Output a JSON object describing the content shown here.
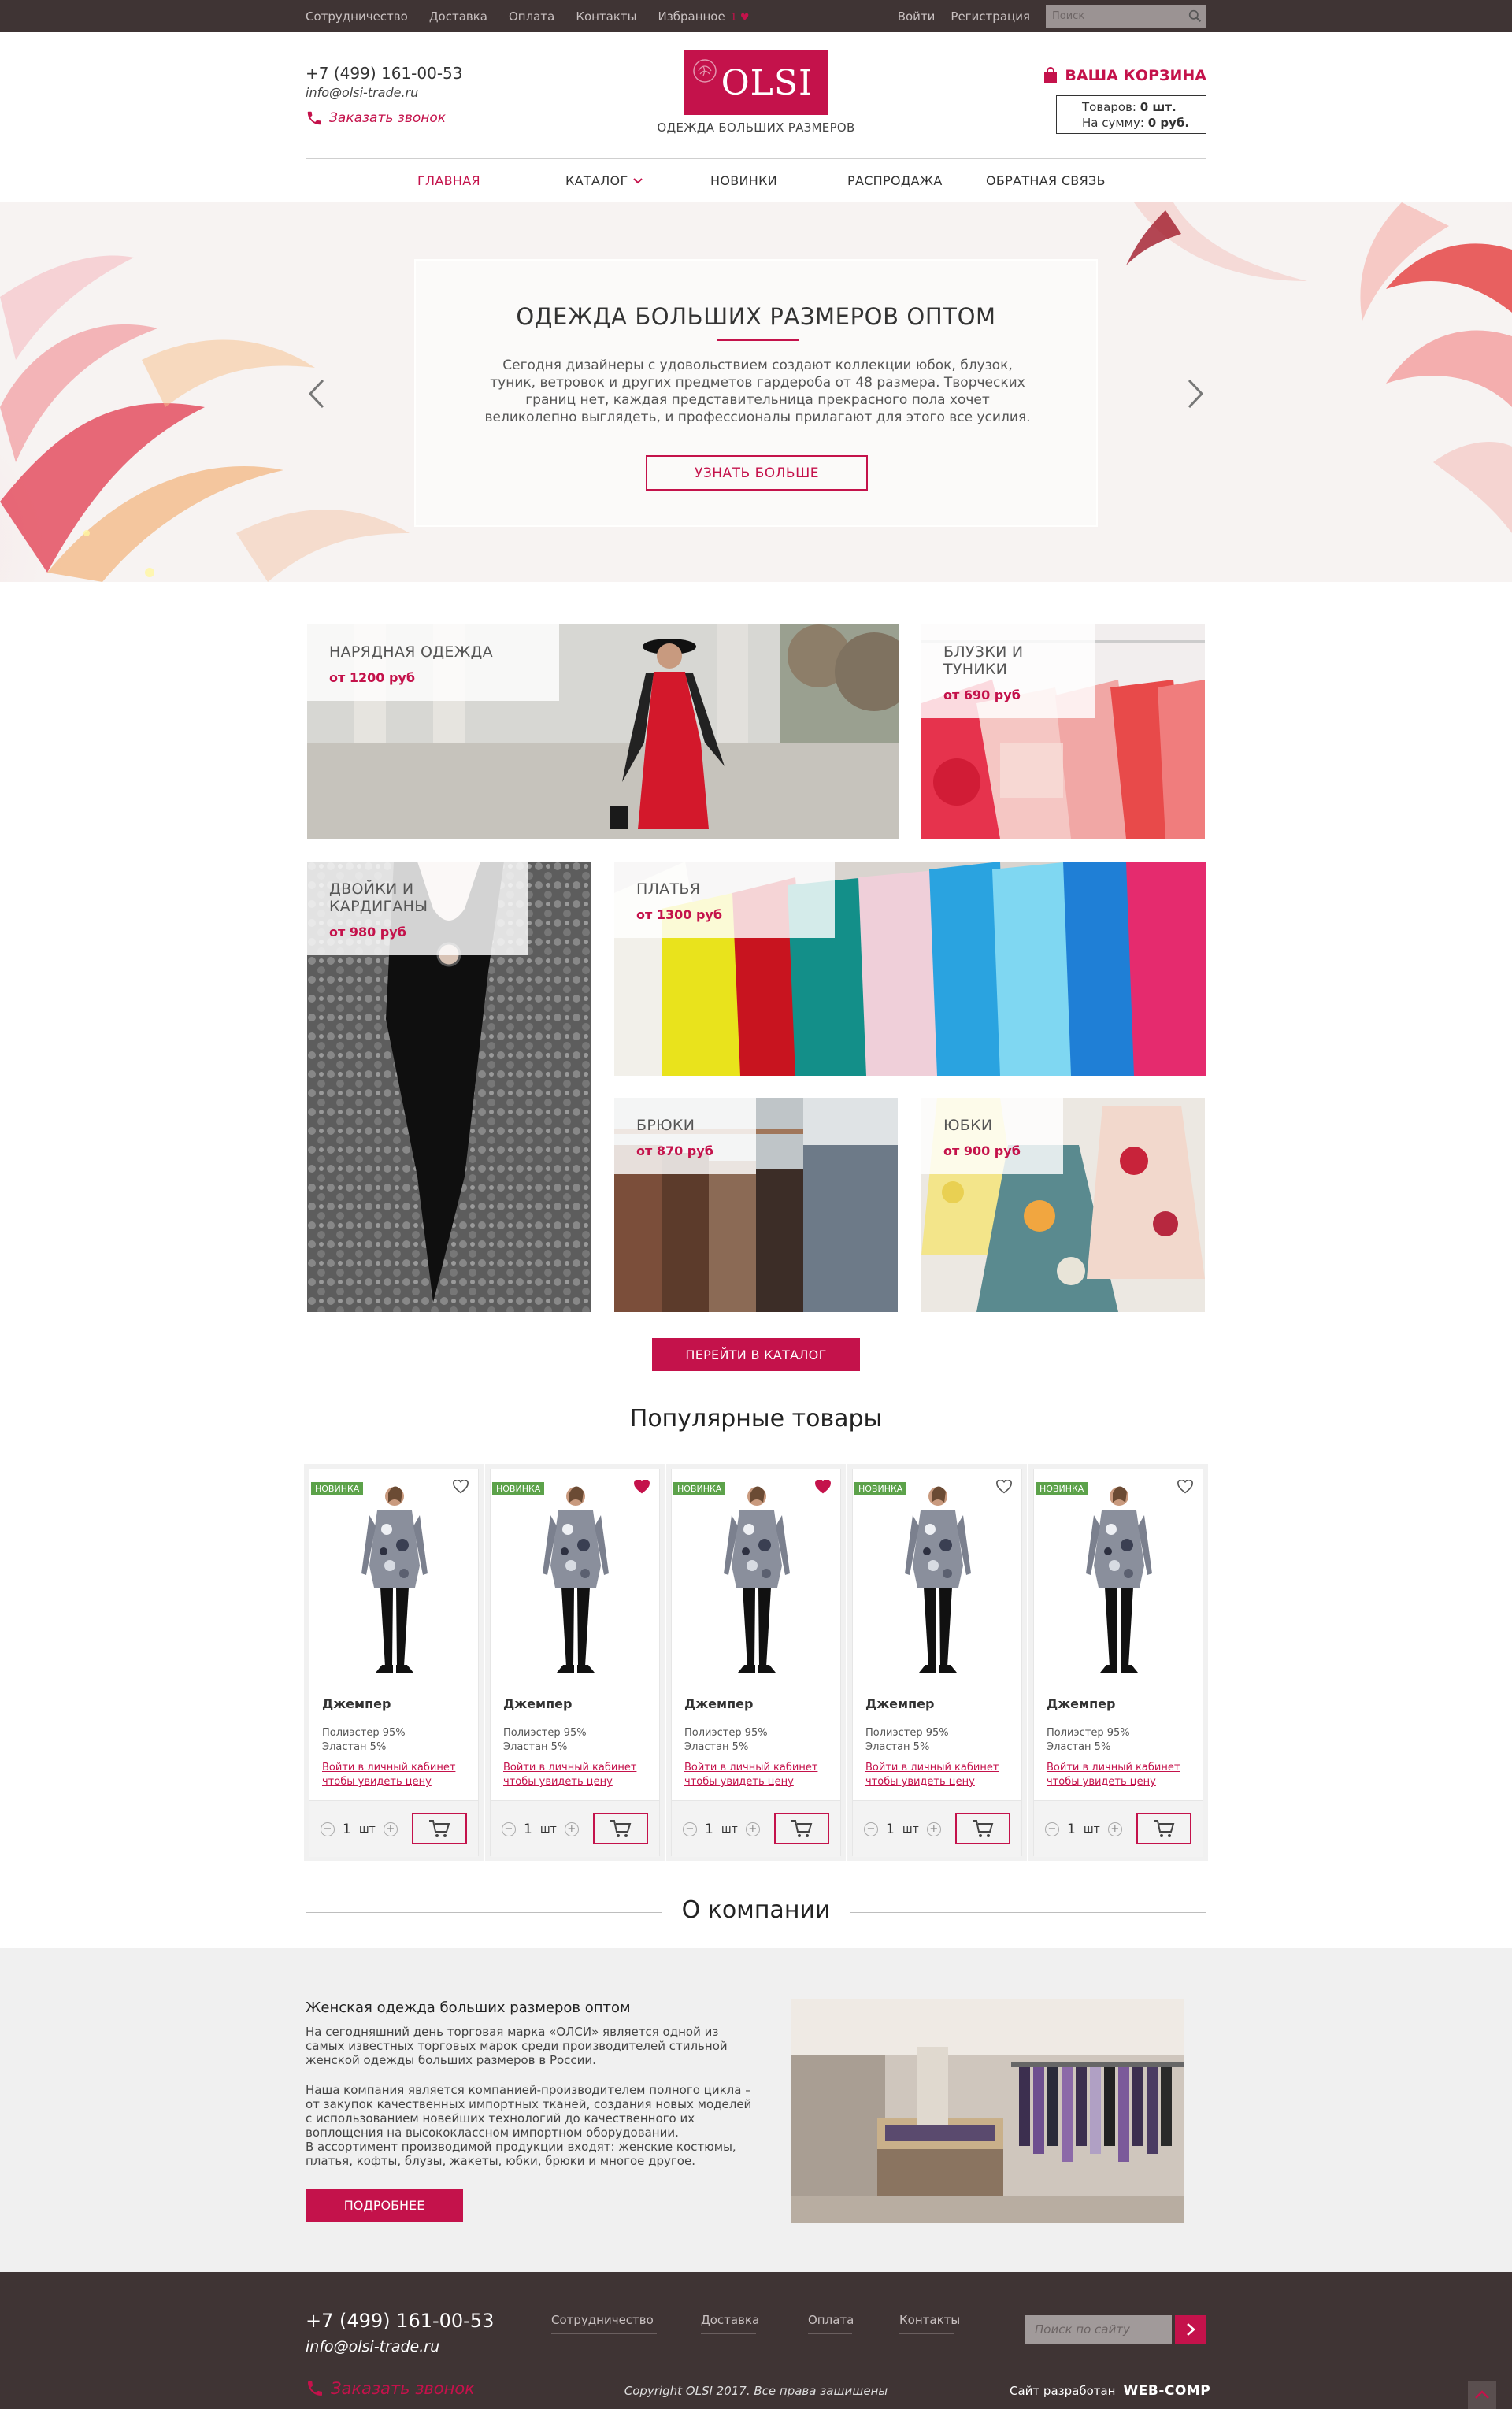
{
  "topbar": {
    "links": [
      "Сотрудничество",
      "Доставка",
      "Оплата",
      "Контакты",
      "Избранное"
    ],
    "fav_count": "1",
    "login": "Войти",
    "register": "Регистрация",
    "search_placeholder": "Поиск"
  },
  "header": {
    "phone": "+7 (499) 161-00-53",
    "email": "info@olsi-trade.ru",
    "callback": "Заказать звонок",
    "logo": "OLSI",
    "tagline": "ОДЕЖДА БОЛЬШИХ РАЗМЕРОВ",
    "cart_title": "ВАША КОРЗИНА",
    "cart_items_label": "Товаров:",
    "cart_items_value": "0 шт.",
    "cart_sum_label": "На сумму:",
    "cart_sum_value": "0 руб."
  },
  "nav": {
    "items": [
      "ГЛАВНАЯ",
      "КАТАЛОГ",
      "НОВИНКИ",
      "РАСПРОДАЖА",
      "ОБРАТНАЯ СВЯЗЬ"
    ]
  },
  "hero": {
    "title": "ОДЕЖДА БОЛЬШИХ РАЗМЕРОВ ОПТОМ",
    "text": "Сегодня дизайнеры с удовольствием создают коллекции юбок, блузок, туник, ветровок и других предметов гардероба от 48 размера. Творческих границ нет, каждая представительница прекрасного пола хочет великолепно выглядеть, и профессионалы прилагают для этого все усилия.",
    "button": "УЗНАТЬ БОЛЬШЕ"
  },
  "categories": [
    {
      "name": "НАРЯДНАЯ ОДЕЖДА",
      "price": "от 1200 руб"
    },
    {
      "name": "БЛУЗКИ И ТУНИКИ",
      "price": "от 690 руб"
    },
    {
      "name": "ДВОЙКИ И КАРДИГАНЫ",
      "price": "от 980 руб"
    },
    {
      "name": "ПЛАТЬЯ",
      "price": "от 1300 руб"
    },
    {
      "name": "БРЮКИ",
      "price": "от 870 руб"
    },
    {
      "name": "ЮБКИ",
      "price": "от 900 руб"
    }
  ],
  "catalog_button": "ПЕРЕЙТИ В КАТАЛОГ",
  "popular": {
    "title": "Популярные товары",
    "products": [
      {
        "badge": "НОВИНКА",
        "name": "Джемпер",
        "desc1": "Полиэстер 95%",
        "desc2": "Эластан 5%",
        "login1": "Войти в личный кабинет",
        "login2": "чтобы увидеть цену",
        "qty": "1",
        "unit": "шт",
        "fav": false
      },
      {
        "badge": "НОВИНКА",
        "name": "Джемпер",
        "desc1": "Полиэстер 95%",
        "desc2": "Эластан 5%",
        "login1": "Войти в личный кабинет",
        "login2": "чтобы увидеть цену",
        "qty": "1",
        "unit": "шт",
        "fav": true
      },
      {
        "badge": "НОВИНКА",
        "name": "Джемпер",
        "desc1": "Полиэстер 95%",
        "desc2": "Эластан 5%",
        "login1": "Войти в личный кабинет",
        "login2": "чтобы увидеть цену",
        "qty": "1",
        "unit": "шт",
        "fav": true
      },
      {
        "badge": "НОВИНКА",
        "name": "Джемпер",
        "desc1": "Полиэстер 95%",
        "desc2": "Эластан 5%",
        "login1": "Войти в личный кабинет",
        "login2": "чтобы увидеть цену",
        "qty": "1",
        "unit": "шт",
        "fav": false
      },
      {
        "badge": "НОВИНКА",
        "name": "Джемпер",
        "desc1": "Полиэстер 95%",
        "desc2": "Эластан 5%",
        "login1": "Войти в личный кабинет",
        "login2": "чтобы увидеть цену",
        "qty": "1",
        "unit": "шт",
        "fav": false
      }
    ]
  },
  "about": {
    "title": "О компании",
    "heading": "Женская одежда больших размеров оптом",
    "p1": "На сегодняшний день торговая марка «ОЛСИ» является одной из самых известных торговых марок среди производителей стильной женской одежды больших размеров в России.",
    "p2": "Наша компания является компанией-производителем полного цикла – от закупок качественных импортных тканей, создания новых моделей с использованием новейших технологий до качественного их воплощения на высококлассном импортном оборудовании.",
    "p3": "В ассортимент производимой продукции входят: женские костюмы, платья, кофты, блузы, жакеты, юбки, брюки и многое другое.",
    "button": "ПОДРОБНЕЕ"
  },
  "footer": {
    "phone": "+7 (499) 161-00-53",
    "email": "info@olsi-trade.ru",
    "callback": "Заказать звонок",
    "links": [
      "Сотрудничество",
      "Доставка",
      "Оплата",
      "Контакты"
    ],
    "search_placeholder": "Поиск по сайту",
    "copyright": "Copyright OLSI 2017. Все права защищены",
    "dev_label": "Сайт разработан",
    "dev_name": "WEB-COMP"
  },
  "colors": {
    "accent": "#c4124b",
    "dark": "#3f3434",
    "new_badge": "#5ca24a"
  }
}
